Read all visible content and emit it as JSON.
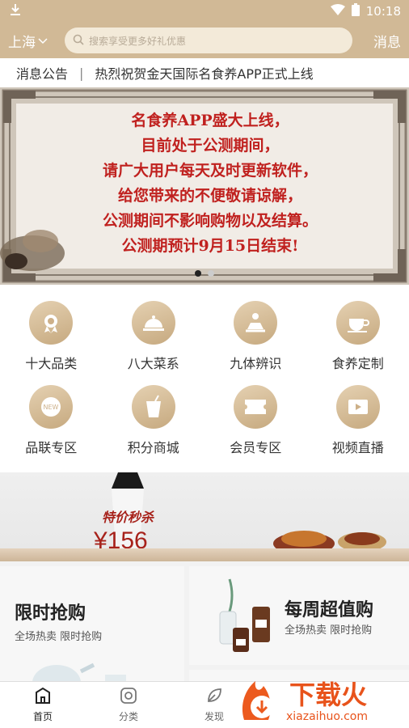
{
  "status": {
    "time": "10:18"
  },
  "header": {
    "city": "上海",
    "search_placeholder": "搜索享受更多好礼优惠",
    "message_label": "消息"
  },
  "notice": {
    "label": "消息公告",
    "separator": "|",
    "text": "热烈祝贺金天国际名食养APP正式上线"
  },
  "banner": {
    "lines": [
      "名食养APP盛大上线，",
      "目前处于公测期间，",
      "请广大用户每天及时更新软件，",
      "给您带来的不便敬请谅解，",
      "公测期间不影响购物以及结算。",
      "公测期预计9月15日结束!"
    ],
    "active_slide": 1,
    "slide_count": 2
  },
  "categories": [
    {
      "label": "十大品类",
      "icon": "award-medal-icon"
    },
    {
      "label": "八大菜系",
      "icon": "serving-dish-icon"
    },
    {
      "label": "九体辨识",
      "icon": "meditation-person-icon"
    },
    {
      "label": "食养定制",
      "icon": "teacup-icon"
    },
    {
      "label": "品联专区",
      "icon": "new-badge-icon"
    },
    {
      "label": "积分商城",
      "icon": "drink-cup-icon"
    },
    {
      "label": "会员专区",
      "icon": "ticket-icon"
    },
    {
      "label": "视频直播",
      "icon": "video-play-icon"
    }
  ],
  "promo": {
    "tag": "特价秒杀",
    "price": "¥156"
  },
  "cards": [
    {
      "title": "限时抢购",
      "subtitle": "全场热卖 限时抢购"
    },
    {
      "title": "每周超值购",
      "subtitle": "全场热卖 限时抢购"
    }
  ],
  "tabbar": [
    {
      "label": "首页",
      "icon": "home-icon",
      "active": true
    },
    {
      "label": "分类",
      "icon": "category-icon",
      "active": false
    },
    {
      "label": "发现",
      "icon": "leaf-icon",
      "active": false
    }
  ],
  "watermark": {
    "text": "下载火",
    "url_text": "xiazaihuo.com"
  },
  "colors": {
    "brand": "#d1b996",
    "icon_bg": "#cdb089",
    "price_red": "#a7221b",
    "banner_red": "#c0211f"
  }
}
